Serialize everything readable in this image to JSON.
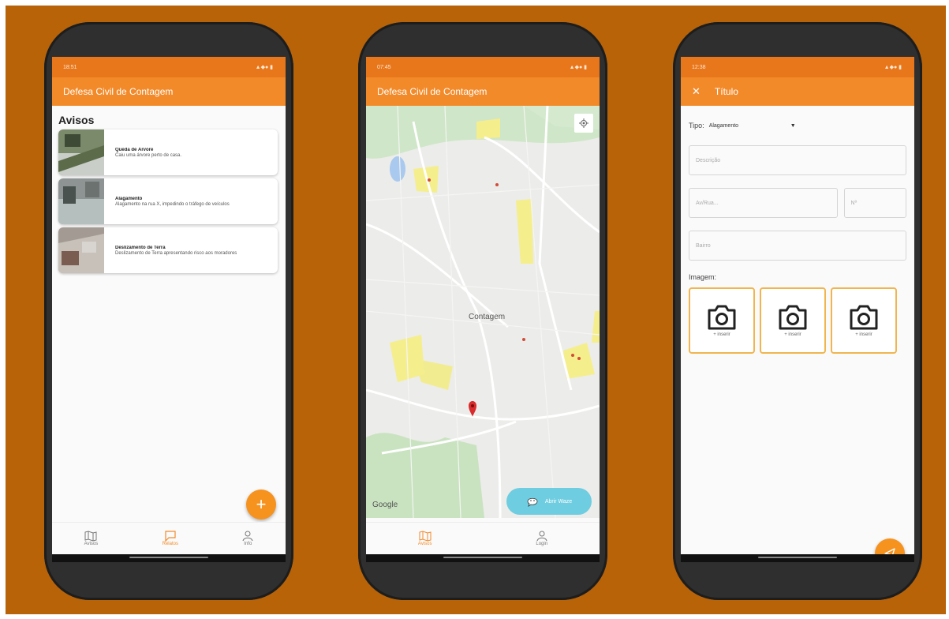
{
  "colors": {
    "background": "#b86308",
    "primary": "#f28a2a",
    "statusbar": "#e8771c",
    "fab": "#f6921e",
    "waze": "#6ecde0"
  },
  "screen1": {
    "status_time": "18:51",
    "appbar_title": "Defesa Civil de Contagem",
    "section_title": "Avisos",
    "cards": [
      {
        "title": "Queda de Árvore",
        "desc": "Caiu uma árvore perto de casa."
      },
      {
        "title": "Alagamento",
        "desc": "Alagamento na rua X, impedindo o tráfego de veículos"
      },
      {
        "title": "Deslizamento de Terra",
        "desc": "Deslizamento de Terra apresentando risco aos moradores"
      }
    ],
    "fab_icon": "plus-icon",
    "fab_label": "+",
    "nav": [
      {
        "label": "Avisos",
        "icon": "map-icon"
      },
      {
        "label": "Relatos",
        "icon": "chat-icon"
      },
      {
        "label": "Info",
        "icon": "person-icon"
      }
    ]
  },
  "screen2": {
    "status_time": "07:45",
    "appbar_title": "Defesa Civil de Contagem",
    "map_label": "Contagem",
    "google_label": "Google",
    "waze_label": "Abrir Waze",
    "nav": [
      {
        "label": "Avisos",
        "icon": "map-icon"
      },
      {
        "label": "Login",
        "icon": "person-icon"
      }
    ]
  },
  "screen3": {
    "status_time": "12:38",
    "appbar_title": "Título",
    "tipo_label": "Tipo:",
    "tipo_value": "Alagamento",
    "descricao_placeholder": "Descrição",
    "rua_placeholder": "Av/Rua...",
    "numero_placeholder": "Nº",
    "bairro_placeholder": "Bairro",
    "imagem_label": "Imagem:",
    "inserir_label": "+ inserir"
  }
}
